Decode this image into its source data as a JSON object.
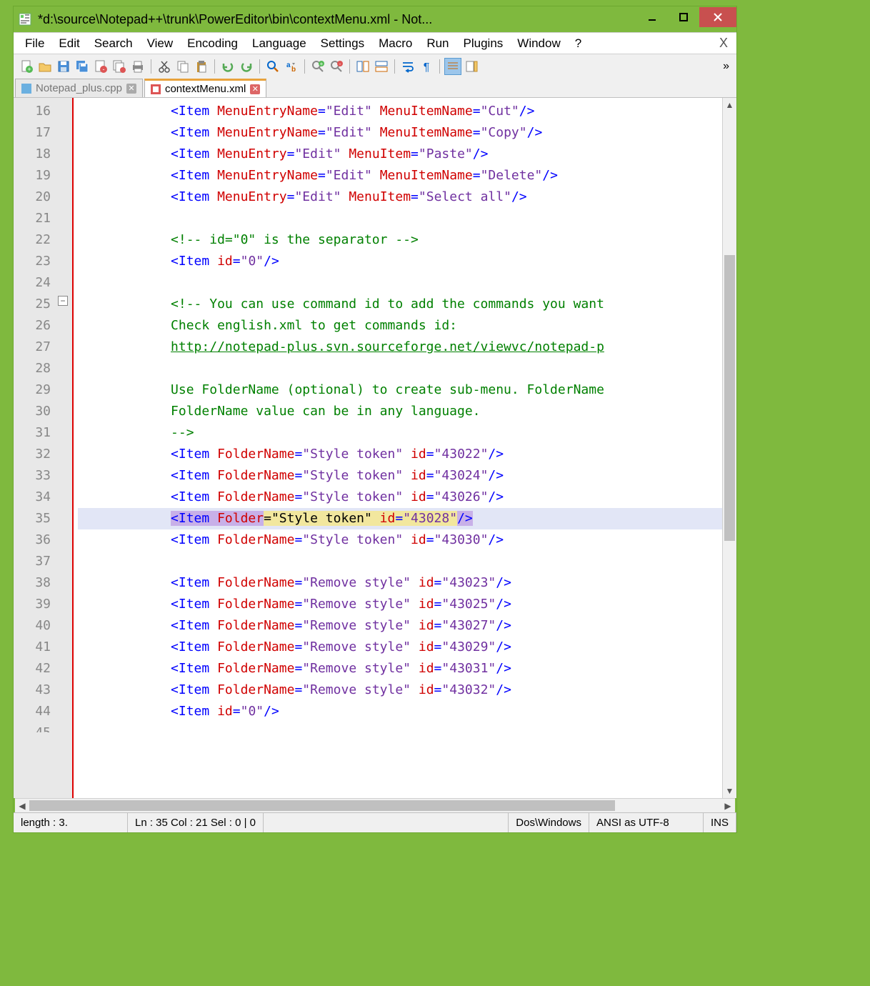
{
  "window": {
    "title": "*d:\\source\\Notepad++\\trunk\\PowerEditor\\bin\\contextMenu.xml - Not..."
  },
  "menubar": {
    "items": [
      "File",
      "Edit",
      "Search",
      "View",
      "Encoding",
      "Language",
      "Settings",
      "Macro",
      "Run",
      "Plugins",
      "Window",
      "?"
    ],
    "close_x": "X"
  },
  "tabs": {
    "t0": {
      "label": "Notepad_plus.cpp"
    },
    "t1": {
      "label": "contextMenu.xml"
    }
  },
  "code": {
    "first_line": 16,
    "lines": {
      "16": {
        "pre": "            ",
        "t": [
          [
            "<Item ",
            "blue"
          ],
          [
            "MenuEntryName",
            "red"
          ],
          [
            "=",
            "blue"
          ],
          [
            "\"Edit\"",
            "purp"
          ],
          [
            " ",
            "blue"
          ],
          [
            "MenuItemName",
            "red"
          ],
          [
            "=",
            "blue"
          ],
          [
            "\"Cut\"",
            "purp"
          ],
          [
            "/>",
            "blue"
          ]
        ]
      },
      "17": {
        "pre": "            ",
        "t": [
          [
            "<Item ",
            "blue"
          ],
          [
            "MenuEntryName",
            "red"
          ],
          [
            "=",
            "blue"
          ],
          [
            "\"Edit\"",
            "purp"
          ],
          [
            " ",
            "blue"
          ],
          [
            "MenuItemName",
            "red"
          ],
          [
            "=",
            "blue"
          ],
          [
            "\"Copy\"",
            "purp"
          ],
          [
            "/>",
            "blue"
          ]
        ]
      },
      "18": {
        "pre": "            ",
        "t": [
          [
            "<Item ",
            "blue"
          ],
          [
            "MenuEntry",
            "red"
          ],
          [
            "=",
            "blue"
          ],
          [
            "\"Edit\"",
            "purp"
          ],
          [
            " ",
            "blue"
          ],
          [
            "MenuItem",
            "red"
          ],
          [
            "=",
            "blue"
          ],
          [
            "\"Paste\"",
            "purp"
          ],
          [
            "/>",
            "blue"
          ]
        ]
      },
      "19": {
        "pre": "            ",
        "t": [
          [
            "<Item ",
            "blue"
          ],
          [
            "MenuEntryName",
            "red"
          ],
          [
            "=",
            "blue"
          ],
          [
            "\"Edit\"",
            "purp"
          ],
          [
            " ",
            "blue"
          ],
          [
            "MenuItemName",
            "red"
          ],
          [
            "=",
            "blue"
          ],
          [
            "\"Delete\"",
            "purp"
          ],
          [
            "/>",
            "blue"
          ]
        ]
      },
      "20": {
        "pre": "            ",
        "t": [
          [
            "<Item ",
            "blue"
          ],
          [
            "MenuEntry",
            "red"
          ],
          [
            "=",
            "blue"
          ],
          [
            "\"Edit\"",
            "purp"
          ],
          [
            " ",
            "blue"
          ],
          [
            "MenuItem",
            "red"
          ],
          [
            "=",
            "blue"
          ],
          [
            "\"Select all\"",
            "purp"
          ],
          [
            "/>",
            "blue"
          ]
        ]
      },
      "21": {
        "pre": "",
        "t": []
      },
      "22": {
        "pre": "            ",
        "t": [
          [
            "<!-- id=\"0\" is the separator -->",
            "green"
          ]
        ]
      },
      "23": {
        "pre": "            ",
        "t": [
          [
            "<Item ",
            "blue"
          ],
          [
            "id",
            "red"
          ],
          [
            "=",
            "blue"
          ],
          [
            "\"0\"",
            "purp"
          ],
          [
            "/>",
            "blue"
          ]
        ]
      },
      "24": {
        "pre": "",
        "t": []
      },
      "25": {
        "pre": "            ",
        "t": [
          [
            "<!-- You can use command id to add the commands you want",
            "green"
          ]
        ]
      },
      "26": {
        "pre": "            ",
        "t": [
          [
            "Check english.xml to get commands id:",
            "green"
          ]
        ]
      },
      "27": {
        "pre": "            ",
        "t": [
          [
            "http://notepad-plus.svn.sourceforge.net/viewvc/notepad-p",
            "link"
          ]
        ]
      },
      "28": {
        "pre": "",
        "t": []
      },
      "29": {
        "pre": "            ",
        "t": [
          [
            "Use FolderName (optional) to create sub-menu. FolderName",
            "green"
          ]
        ]
      },
      "30": {
        "pre": "            ",
        "t": [
          [
            "FolderName value can be in any language.",
            "green"
          ]
        ]
      },
      "31": {
        "pre": "            ",
        "t": [
          [
            "-->",
            "green"
          ]
        ]
      },
      "32": {
        "pre": "            ",
        "t": [
          [
            "<Item ",
            "blue"
          ],
          [
            "FolderName",
            "red"
          ],
          [
            "=",
            "blue"
          ],
          [
            "\"Style token\"",
            "purp"
          ],
          [
            " ",
            "blue"
          ],
          [
            "id",
            "red"
          ],
          [
            "=",
            "blue"
          ],
          [
            "\"43022\"",
            "purp"
          ],
          [
            "/>",
            "blue"
          ]
        ]
      },
      "33": {
        "pre": "            ",
        "t": [
          [
            "<Item ",
            "blue"
          ],
          [
            "FolderName",
            "red"
          ],
          [
            "=",
            "blue"
          ],
          [
            "\"Style token\"",
            "purp"
          ],
          [
            " ",
            "blue"
          ],
          [
            "id",
            "red"
          ],
          [
            "=",
            "blue"
          ],
          [
            "\"43024\"",
            "purp"
          ],
          [
            "/>",
            "blue"
          ]
        ]
      },
      "34": {
        "pre": "            ",
        "t": [
          [
            "<Item ",
            "blue"
          ],
          [
            "FolderName",
            "red"
          ],
          [
            "=",
            "blue"
          ],
          [
            "\"Style token\"",
            "purp"
          ],
          [
            " ",
            "blue"
          ],
          [
            "id",
            "red"
          ],
          [
            "=",
            "blue"
          ],
          [
            "\"43026\"",
            "purp"
          ],
          [
            "/>",
            "blue"
          ]
        ]
      },
      "35": {
        "pre": "            ",
        "hl": true,
        "diff": true,
        "t": [
          [
            "<Item ",
            "blue",
            "d1"
          ],
          [
            "Folder",
            "red",
            "d1"
          ],
          [
            "=\"Style token\" ",
            "",
            "d2"
          ],
          [
            "id",
            "red",
            "d2"
          ],
          [
            "=",
            "blue",
            "d2"
          ],
          [
            "\"43028\"",
            "purp",
            "d2"
          ],
          [
            "/>",
            "blue",
            "d1"
          ]
        ]
      },
      "36": {
        "pre": "            ",
        "t": [
          [
            "<Item ",
            "blue"
          ],
          [
            "FolderName",
            "red"
          ],
          [
            "=",
            "blue"
          ],
          [
            "\"Style token\"",
            "purp"
          ],
          [
            " ",
            "blue"
          ],
          [
            "id",
            "red"
          ],
          [
            "=",
            "blue"
          ],
          [
            "\"43030\"",
            "purp"
          ],
          [
            "/>",
            "blue"
          ]
        ]
      },
      "37": {
        "pre": "",
        "t": []
      },
      "38": {
        "pre": "            ",
        "t": [
          [
            "<Item ",
            "blue"
          ],
          [
            "FolderName",
            "red"
          ],
          [
            "=",
            "blue"
          ],
          [
            "\"Remove style\"",
            "purp"
          ],
          [
            " ",
            "blue"
          ],
          [
            "id",
            "red"
          ],
          [
            "=",
            "blue"
          ],
          [
            "\"43023\"",
            "purp"
          ],
          [
            "/>",
            "blue"
          ]
        ]
      },
      "39": {
        "pre": "            ",
        "t": [
          [
            "<Item ",
            "blue"
          ],
          [
            "FolderName",
            "red"
          ],
          [
            "=",
            "blue"
          ],
          [
            "\"Remove style\"",
            "purp"
          ],
          [
            " ",
            "blue"
          ],
          [
            "id",
            "red"
          ],
          [
            "=",
            "blue"
          ],
          [
            "\"43025\"",
            "purp"
          ],
          [
            "/>",
            "blue"
          ]
        ]
      },
      "40": {
        "pre": "            ",
        "t": [
          [
            "<Item ",
            "blue"
          ],
          [
            "FolderName",
            "red"
          ],
          [
            "=",
            "blue"
          ],
          [
            "\"Remove style\"",
            "purp"
          ],
          [
            " ",
            "blue"
          ],
          [
            "id",
            "red"
          ],
          [
            "=",
            "blue"
          ],
          [
            "\"43027\"",
            "purp"
          ],
          [
            "/>",
            "blue"
          ]
        ]
      },
      "41": {
        "pre": "            ",
        "t": [
          [
            "<Item ",
            "blue"
          ],
          [
            "FolderName",
            "red"
          ],
          [
            "=",
            "blue"
          ],
          [
            "\"Remove style\"",
            "purp"
          ],
          [
            " ",
            "blue"
          ],
          [
            "id",
            "red"
          ],
          [
            "=",
            "blue"
          ],
          [
            "\"43029\"",
            "purp"
          ],
          [
            "/>",
            "blue"
          ]
        ]
      },
      "42": {
        "pre": "            ",
        "t": [
          [
            "<Item ",
            "blue"
          ],
          [
            "FolderName",
            "red"
          ],
          [
            "=",
            "blue"
          ],
          [
            "\"Remove style\"",
            "purp"
          ],
          [
            " ",
            "blue"
          ],
          [
            "id",
            "red"
          ],
          [
            "=",
            "blue"
          ],
          [
            "\"43031\"",
            "purp"
          ],
          [
            "/>",
            "blue"
          ]
        ]
      },
      "43": {
        "pre": "            ",
        "t": [
          [
            "<Item ",
            "blue"
          ],
          [
            "FolderName",
            "red"
          ],
          [
            "=",
            "blue"
          ],
          [
            "\"Remove style\"",
            "purp"
          ],
          [
            " ",
            "blue"
          ],
          [
            "id",
            "red"
          ],
          [
            "=",
            "blue"
          ],
          [
            "\"43032\"",
            "purp"
          ],
          [
            "/>",
            "blue"
          ]
        ]
      },
      "44": {
        "pre": "            ",
        "t": [
          [
            "<Item ",
            "blue"
          ],
          [
            "id",
            "red"
          ],
          [
            "=",
            "blue"
          ],
          [
            "\"0\"",
            "purp"
          ],
          [
            "/>",
            "blue"
          ]
        ]
      }
    }
  },
  "status": {
    "length": "length : 3.",
    "pos": "Ln : 35    Col : 21    Sel : 0 | 0",
    "eol": "Dos\\Windows",
    "enc": "ANSI as UTF-8",
    "mode": "INS"
  }
}
